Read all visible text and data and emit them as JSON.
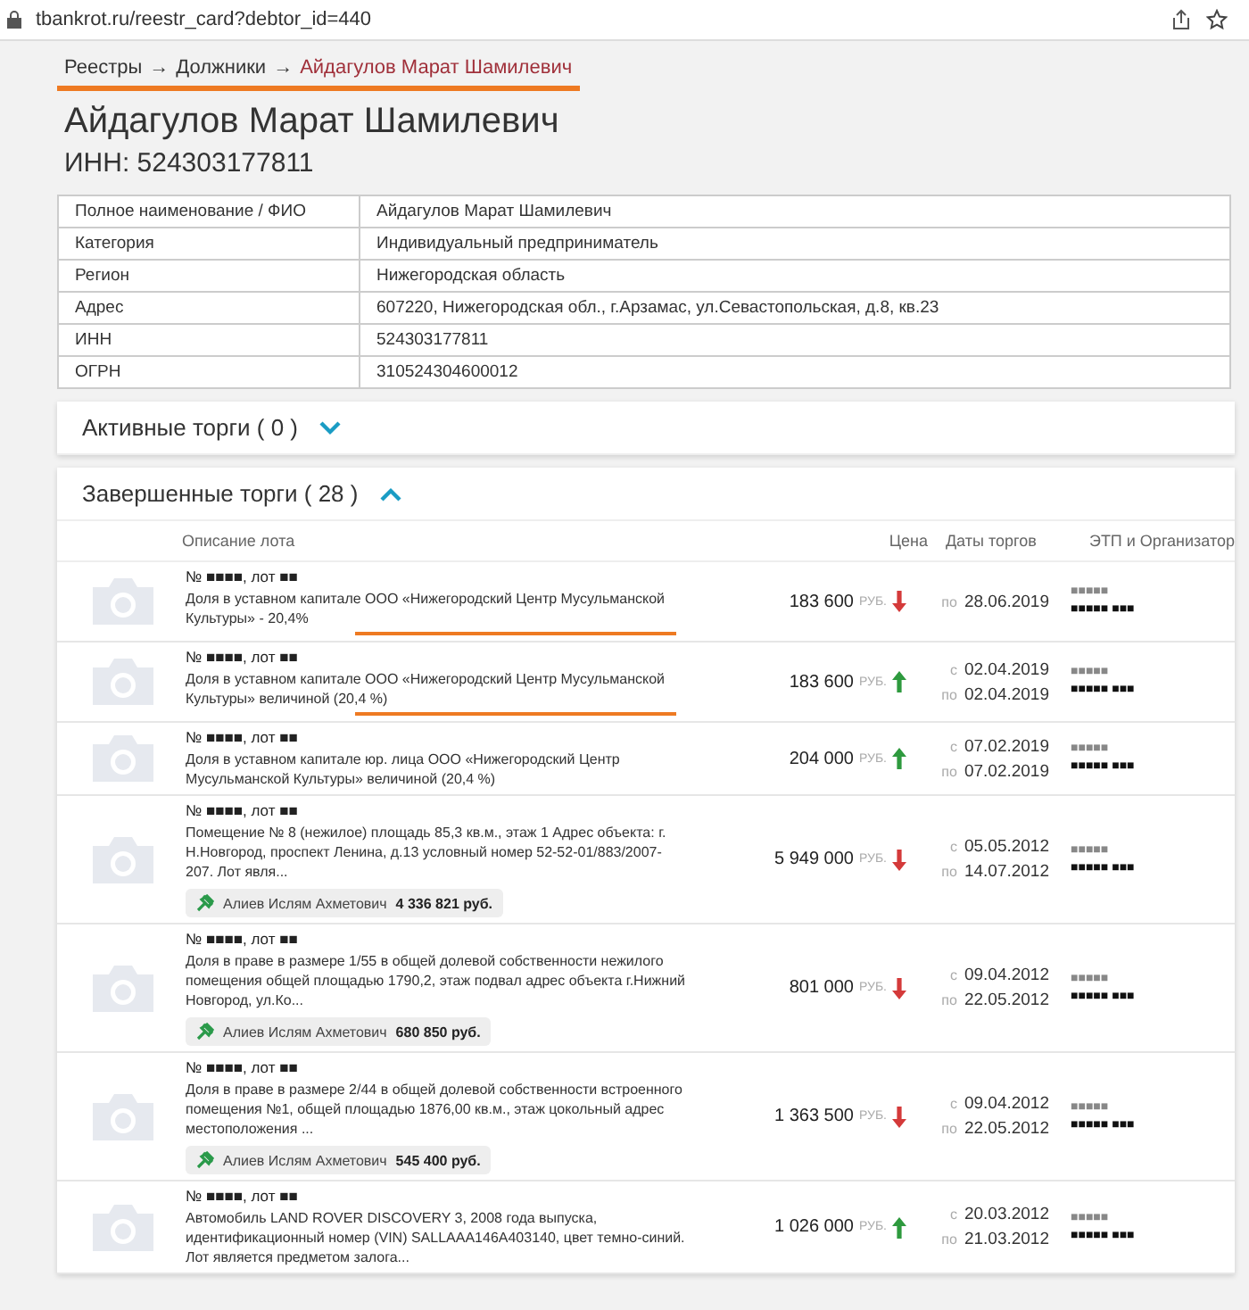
{
  "browser": {
    "url": "tbankrot.ru/reestr_card?debtor_id=440"
  },
  "breadcrumb": {
    "items": [
      "Реестры",
      "Должники"
    ],
    "current": "Айдагулов Марат Шамилевич",
    "separator": "→",
    "underlined": true
  },
  "title": "Айдагулов Марат Шамилевич",
  "inn_heading": "ИНН: 524303177811",
  "info_table": [
    {
      "label": "Полное наименование / ФИО",
      "value": "Айдагулов Марат Шамилевич"
    },
    {
      "label": "Категория",
      "value": "Индивидуальный предприниматель"
    },
    {
      "label": "Регион",
      "value": "Нижегородская область"
    },
    {
      "label": "Адрес",
      "value": "607220, Нижегородская обл., г.Арзамас, ул.Севастопольская, д.8, кв.23"
    },
    {
      "label": "ИНН",
      "value": "524303177811"
    },
    {
      "label": "ОГРН",
      "value": "310524304600012"
    }
  ],
  "sections": [
    {
      "title": "Активные торги ( 0 )",
      "expanded": false
    },
    {
      "title": "Завершенные торги ( 28 )",
      "expanded": true
    }
  ],
  "lots_table": {
    "columns": [
      "Описание лота",
      "Цена",
      "Даты торгов",
      "ЭТП и Организатор"
    ],
    "rows": [
      {
        "number": "№ ■■■■, лот ■■",
        "description": "Доля в уставном капитале ООО «Нижегородский Центр Мусульманской Культуры» - 20,4%",
        "underlined": true,
        "price": "183 600",
        "currency": "РУБ.",
        "kind": "down",
        "dates": [
          {
            "prefix": "по",
            "date": "28.06.2019"
          }
        ],
        "etp": "■■■■■",
        "organizer": "■■■■■ ■■■"
      },
      {
        "number": "№ ■■■■, лот ■■",
        "description": "Доля в уставном капитале ООО «Нижегородский Центр Мусульманской Культуры» величиной (20,4 %)",
        "underlined": true,
        "price": "183 600",
        "currency": "РУБ.",
        "kind": "up",
        "dates": [
          {
            "prefix": "с",
            "date": "02.04.2019"
          },
          {
            "prefix": "по",
            "date": "02.04.2019"
          }
        ],
        "etp": "■■■■■",
        "organizer": "■■■■■ ■■■"
      },
      {
        "number": "№ ■■■■, лот ■■",
        "description": "Доля в уставном капитале юр. лица ООО «Нижегородский Центр Мусульманской Культуры» величиной (20,4 %)",
        "underlined": false,
        "price": "204 000",
        "currency": "РУБ.",
        "kind": "up",
        "dates": [
          {
            "prefix": "с",
            "date": "07.02.2019"
          },
          {
            "prefix": "по",
            "date": "07.02.2019"
          }
        ],
        "etp": "■■■■■",
        "organizer": "■■■■■ ■■■"
      },
      {
        "number": "№ ■■■■, лот ■■",
        "description": "Помещение № 8 (нежилое) площадь 85,3 кв.м., этаж 1 Адрес объекта: г. Н.Новгород, проспект Ленина, д.13 условный номер 52-52-01/883/2007-207. Лот явля...",
        "underlined": false,
        "winner": "Алиев Ислям Ахметович",
        "winner_price": "4 336 821 руб.",
        "price": "5 949 000",
        "currency": "РУБ.",
        "kind": "down",
        "dates": [
          {
            "prefix": "с",
            "date": "05.05.2012"
          },
          {
            "prefix": "по",
            "date": "14.07.2012"
          }
        ],
        "etp": "■■■■■",
        "organizer": "■■■■■ ■■■"
      },
      {
        "number": "№ ■■■■, лот ■■",
        "description": "Доля в праве в размере 1/55 в общей долевой собственности нежилого помещения общей площадью 1790,2, этаж подвал адрес объекта г.Нижний Новгород, ул.Ко...",
        "underlined": false,
        "winner": "Алиев Ислям Ахметович",
        "winner_price": "680 850 руб.",
        "price": "801 000",
        "currency": "РУБ.",
        "kind": "down",
        "dates": [
          {
            "prefix": "с",
            "date": "09.04.2012"
          },
          {
            "prefix": "по",
            "date": "22.05.2012"
          }
        ],
        "etp": "■■■■■",
        "organizer": "■■■■■ ■■■"
      },
      {
        "number": "№ ■■■■, лот ■■",
        "description": "Доля в праве в размере 2/44 в общей долевой собственности встроенного помещения №1, общей площадью 1876,00 кв.м., этаж цокольный адрес местоположения ...",
        "underlined": false,
        "winner": "Алиев Ислям Ахметович",
        "winner_price": "545 400 руб.",
        "price": "1 363 500",
        "currency": "РУБ.",
        "kind": "down",
        "dates": [
          {
            "prefix": "с",
            "date": "09.04.2012"
          },
          {
            "prefix": "по",
            "date": "22.05.2012"
          }
        ],
        "etp": "■■■■■",
        "organizer": "■■■■■ ■■■"
      },
      {
        "number": "№ ■■■■, лот ■■",
        "description": "Автомобиль LAND ROVER DISCOVERY 3, 2008 года выпуска, идентификационный номер (VIN) SALLAAA146A403140, цвет темно-синий. Лот является предметом залога...",
        "underlined": false,
        "price": "1 026 000",
        "currency": "РУБ.",
        "kind": "up",
        "dates": [
          {
            "prefix": "с",
            "date": "20.03.2012"
          },
          {
            "prefix": "по",
            "date": "21.03.2012"
          }
        ],
        "etp": "■■■■■",
        "organizer": "■■■■■ ■■■"
      }
    ]
  }
}
